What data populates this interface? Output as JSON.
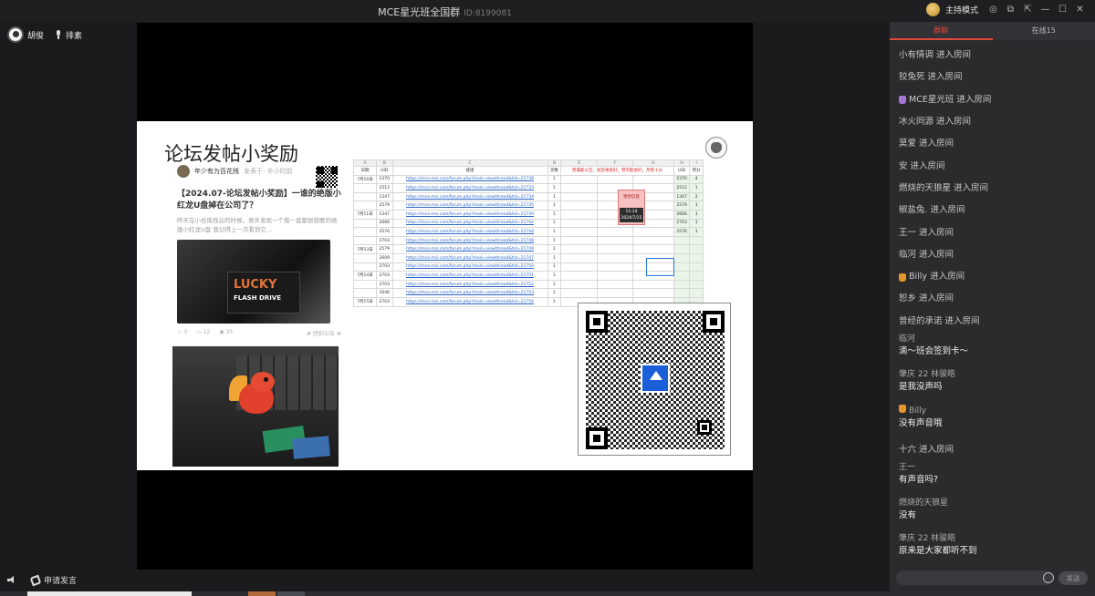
{
  "window": {
    "title": "MCE星光班全国群",
    "room_id": "ID:8199081",
    "mode": "主持模式"
  },
  "speakers": [
    {
      "name": "胡俊"
    },
    {
      "name": "排素"
    }
  ],
  "slide": {
    "title": "论坛发帖小奖励",
    "post": {
      "author": "年少有为百花残",
      "meta": "发表于: 半小时前",
      "headline": "【2024.07-论坛发帖小奖励】一谁的绝版小红龙U盘掉在公司了？",
      "excerpt": "昨天在小仓库找云的时候，意外发现一个我一直都很想要的绝版小红龙U盘 我记得上一次看到它...",
      "usb_text_1": "LUCKY",
      "usb_text_2": "FLASH DRIVE",
      "stats": {
        "likes": "0",
        "comments": "12",
        "views": "35",
        "tag": "# 团扣公告 #"
      }
    },
    "sheet": {
      "col_letters": [
        "A",
        "B",
        "C",
        "D",
        "E",
        "F",
        "G",
        "H",
        "I"
      ],
      "headers": [
        "日期",
        "UID",
        "链接",
        "次数",
        "",
        "",
        "",
        "UID",
        "积分"
      ],
      "header_note": "赞满能公告，就及格就好，赞可能会好，月底十分",
      "rows": [
        {
          "date": "7月10日",
          "uid": "2370",
          "link": "https://mce.msi.com/forum.php?mod=viewthread&tid=21738",
          "count": "1",
          "uid2": "2370",
          "score": "4"
        },
        {
          "date": "",
          "uid": "2512",
          "link": "https://mce.msi.com/forum.php?mod=viewthread&tid=21733",
          "count": "1",
          "uid2": "2512",
          "score": "1"
        },
        {
          "date": "",
          "uid": "1347",
          "link": "https://mce.msi.com/forum.php?mod=viewthread&tid=21734",
          "count": "1",
          "uid2": "1347",
          "score": "2"
        },
        {
          "date": "",
          "uid": "2579",
          "link": "https://mce.msi.com/forum.php?mod=viewthread&tid=21735",
          "count": "1",
          "uid2": "2579",
          "score": "1"
        },
        {
          "date": "7月11日",
          "uid": "1347",
          "link": "https://mce.msi.com/forum.php?mod=viewthread&tid=21739",
          "count": "1",
          "uid2": "2666",
          "score": "1"
        },
        {
          "date": "",
          "uid": "2666",
          "link": "https://mce.msi.com/forum.php?mod=viewthread&tid=21742",
          "count": "1",
          "uid2": "2703",
          "score": "1"
        },
        {
          "date": "",
          "uid": "2576",
          "link": "https://mce.msi.com/forum.php?mod=viewthread&tid=21744",
          "count": "1",
          "uid2": "2576",
          "score": "1"
        },
        {
          "date": "",
          "uid": "2703",
          "link": "https://mce.msi.com/forum.php?mod=viewthread&tid=21748",
          "count": "1",
          "uid2": "",
          "score": ""
        },
        {
          "date": "7月13日",
          "uid": "2579",
          "link": "https://mce.msi.com/forum.php?mod=viewthread&tid=21749",
          "count": "1",
          "uid2": "",
          "score": ""
        },
        {
          "date": "",
          "uid": "2609",
          "link": "https://mce.msi.com/forum.php?mod=viewthread&tid=21747",
          "count": "1",
          "uid2": "",
          "score": ""
        },
        {
          "date": "",
          "uid": "2703",
          "link": "https://mce.msi.com/forum.php?mod=viewthread&tid=21750",
          "count": "1",
          "uid2": "",
          "score": ""
        },
        {
          "date": "7月14日",
          "uid": "2703",
          "link": "https://mce.msi.com/forum.php?mod=viewthread&tid=21751",
          "count": "1",
          "uid2": "",
          "score": ""
        },
        {
          "date": "",
          "uid": "2703",
          "link": "https://mce.msi.com/forum.php?mod=viewthread&tid=21752",
          "count": "1",
          "uid2": "",
          "score": ""
        },
        {
          "date": "",
          "uid": "1646",
          "link": "https://mce.msi.com/forum.php?mod=viewthread&tid=21753",
          "count": "1",
          "uid2": "",
          "score": ""
        },
        {
          "date": "7月15日",
          "uid": "2703",
          "link": "https://mce.msi.com/forum.php?mod=viewthread&tid=21754",
          "count": "1",
          "uid2": "",
          "score": ""
        }
      ],
      "badge_top": "更新信息",
      "badge_time": "11:14",
      "badge_date": "2024/7/15"
    }
  },
  "bottom": {
    "apply_speak": "申请发言"
  },
  "chat": {
    "tabs": [
      {
        "label": "群聊",
        "active": true
      },
      {
        "label": "在线15",
        "active": false
      }
    ],
    "messages": [
      {
        "type": "join",
        "user": "小有情调",
        "action": "进入房间"
      },
      {
        "type": "join",
        "user": "狡兔死",
        "action": "进入房间"
      },
      {
        "type": "join",
        "user": "MCE星光班",
        "action": "进入房间",
        "badge": "purple"
      },
      {
        "type": "join",
        "user": "冰火同源",
        "action": "进入房间"
      },
      {
        "type": "join",
        "user": "莫爱",
        "action": "进入房间"
      },
      {
        "type": "join",
        "user": "安",
        "action": "进入房间"
      },
      {
        "type": "join",
        "user": "燃烧的天狼星",
        "action": "进入房间"
      },
      {
        "type": "join",
        "user": "椒盐兔.",
        "action": "进入房间"
      },
      {
        "type": "join",
        "user": "王一",
        "action": "进入房间"
      },
      {
        "type": "join",
        "user": "临河",
        "action": "进入房间"
      },
      {
        "type": "join",
        "user": "Billy",
        "action": "进入房间",
        "badge": "crown"
      },
      {
        "type": "join",
        "user": "恕乡",
        "action": "进入房间"
      },
      {
        "type": "join",
        "user": "曾经的承诺",
        "action": "进入房间"
      },
      {
        "type": "chat",
        "user": "临河",
        "text": "滴～班会签到卡～"
      },
      {
        "type": "chat",
        "user": "肇庆 22 林骏皓",
        "text": "是我没声吗"
      },
      {
        "type": "chat",
        "user": "Billy",
        "text": "没有声音哦",
        "badge": "crown"
      },
      {
        "type": "join",
        "user": "十六",
        "action": "进入房间"
      },
      {
        "type": "chat",
        "user": "王一",
        "text": "有声音吗?"
      },
      {
        "type": "chat",
        "user": "燃烧的天狼星",
        "text": "没有"
      },
      {
        "type": "chat",
        "user": "肇庆 22 林骏皓",
        "text": "原来是大家都听不到"
      }
    ],
    "send_label": "发送"
  }
}
